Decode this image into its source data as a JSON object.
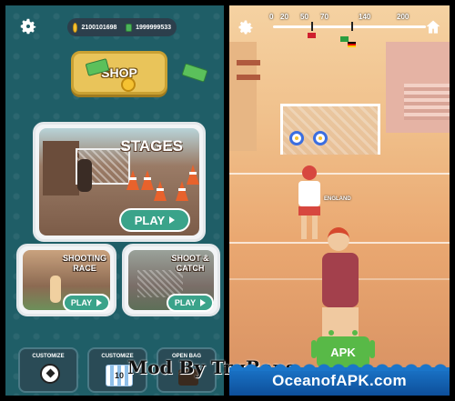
{
  "menu": {
    "coins": "2100101698",
    "cash": "1999999533",
    "shop_label": "SHOP",
    "stages": {
      "title": "STAGES",
      "play_label": "PLAY"
    },
    "shooting_race": {
      "title_line1": "SHOOTING",
      "title_line2": "RACE",
      "play_label": "PLAY"
    },
    "shoot_catch": {
      "title_line1": "SHOOT &",
      "title_line2": "CATCH",
      "play_label": "PLAY"
    },
    "bottom": [
      {
        "label": "CUSTOMIZE",
        "icon": "soccer-ball-icon"
      },
      {
        "label": "CUSTOMIZE",
        "icon": "jersey-icon",
        "number": "10"
      },
      {
        "label": "OPEN BAG",
        "icon": "bag-icon"
      }
    ]
  },
  "game": {
    "progress_ticks": [
      "0",
      "20",
      "50",
      "70",
      "140",
      "200"
    ],
    "player_name": "ENGLAND"
  },
  "overlays": {
    "watermark": "Mod By TrgRaps",
    "apk_label": "APK",
    "banner": "OceanofAPK.com"
  },
  "colors": {
    "menu_bg": "#1f5e67",
    "play_green": "#3aa38a",
    "shop_yellow": "#e9c45a",
    "banner_blue": "#1a75c9"
  }
}
